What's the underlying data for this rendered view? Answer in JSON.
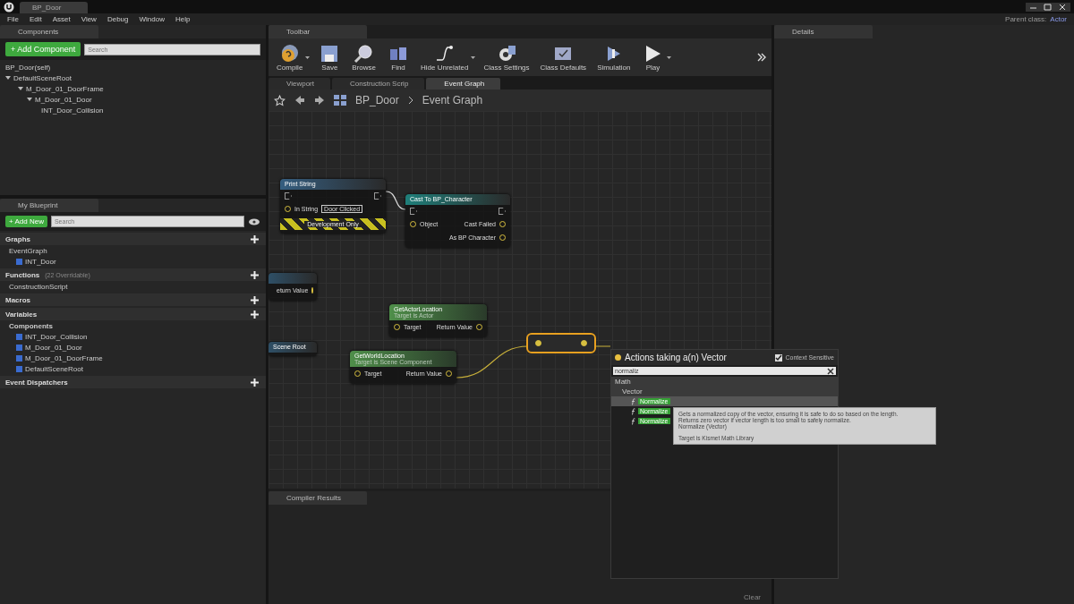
{
  "title_tab": {
    "label": "BP_Door"
  },
  "menu": [
    "File",
    "Edit",
    "Asset",
    "View",
    "Debug",
    "Window",
    "Help"
  ],
  "parent_class": {
    "label": "Parent class:",
    "value": "Actor"
  },
  "components": {
    "title": "Components",
    "add_button": "+ Add Component",
    "search": {
      "placeholder": "Search"
    },
    "tree": [
      {
        "label": "BP_Door(self)"
      },
      {
        "label": "DefaultSceneRoot",
        "children": [
          {
            "label": "M_Door_01_DoorFrame",
            "children": [
              {
                "label": "M_Door_01_Door",
                "children": [
                  {
                    "label": "INT_Door_Collision"
                  }
                ]
              }
            ]
          }
        ]
      }
    ]
  },
  "my_blueprint": {
    "title": "My Blueprint",
    "add_button": "+ Add New",
    "search": {
      "placeholder": "Search"
    },
    "sections": [
      {
        "label": "Graphs",
        "items": [
          {
            "label": "EventGraph",
            "children": [
              {
                "label": "INT_Door"
              }
            ]
          }
        ]
      },
      {
        "label": "Functions",
        "note": "(22 Overridable)",
        "items": [
          {
            "label": "ConstructionScript"
          }
        ]
      },
      {
        "label": "Macros"
      },
      {
        "label": "Variables",
        "items": [
          {
            "label": "Components",
            "children": [
              {
                "label": "INT_Door_Collision"
              },
              {
                "label": "M_Door_01_Door"
              },
              {
                "label": "M_Door_01_DoorFrame"
              },
              {
                "label": "DefaultSceneRoot"
              }
            ]
          }
        ]
      },
      {
        "label": "Event Dispatchers"
      }
    ]
  },
  "toolbar": {
    "title": "Toolbar",
    "buttons": [
      {
        "kind": "compile",
        "label": "Compile",
        "dropdown": true
      },
      {
        "kind": "save",
        "label": "Save",
        "dropdown": false
      },
      {
        "kind": "browse",
        "label": "Browse",
        "dropdown": false
      },
      {
        "kind": "find",
        "label": "Find",
        "dropdown": false
      },
      {
        "kind": "hide",
        "label": "Hide Unrelated",
        "dropdown": true
      },
      {
        "kind": "settings",
        "label": "Class Settings",
        "dropdown": false
      },
      {
        "kind": "defaults",
        "label": "Class Defaults",
        "dropdown": false
      },
      {
        "kind": "simulation",
        "label": "Simulation",
        "dropdown": false
      },
      {
        "kind": "play",
        "label": "Play",
        "dropdown": true
      }
    ]
  },
  "editor_tabs": [
    {
      "label": "Viewport",
      "selected": false
    },
    {
      "label": "Construction Scrip",
      "selected": false
    },
    {
      "label": "Event Graph",
      "selected": true
    }
  ],
  "breadcrumb": [
    "BP_Door",
    "Event Graph"
  ],
  "nodes": [
    {
      "kind": "print",
      "title": "Print String",
      "selected": false,
      "pins": [
        {
          "label": "In String",
          "value": "Door Clicked"
        }
      ],
      "footer": "Development Only"
    },
    {
      "kind": "cast",
      "title": "Cast To BP_Character",
      "selected": false,
      "pins": [
        {
          "label": "Object",
          "out": "Cast Failed"
        },
        {
          "out": "As BP Character"
        }
      ]
    },
    {
      "kind": "partial",
      "selected": false,
      "pins": [
        {
          "out": "eturn Value"
        }
      ]
    },
    {
      "kind": "var",
      "title": "Scene Root",
      "selected": false
    },
    {
      "kind": "function",
      "title": "GetActorLocation",
      "subtitle": "Target is Actor",
      "selected": false,
      "pins": [
        {
          "label": "Target",
          "out": "Return Value"
        }
      ]
    },
    {
      "kind": "function",
      "title": "GetWorldLocation",
      "subtitle": "Target is Scene Component",
      "selected": false,
      "pins": [
        {
          "label": "Target",
          "out": "Return Value"
        }
      ]
    },
    {
      "kind": "reroute",
      "selected": true
    }
  ],
  "action_menu": {
    "title": "Actions taking a(n) Vector",
    "context_sensitive": {
      "label": "Context Sensitive",
      "checked": true
    },
    "search": {
      "value": "normaliz"
    },
    "tree": [
      {
        "label": "Math",
        "children": [
          {
            "label": "Vector",
            "children": [
              {
                "label": "Normalize",
                "selected": true
              },
              {
                "label": "Normalize",
                "selected": false
              },
              {
                "label": "Normalize",
                "selected": false
              }
            ]
          }
        ]
      }
    ],
    "tooltip": [
      "Gets a normalized copy of the vector, ensuring it is safe to do so based on the length.",
      "Returns zero vector if vector length is too small to safely normalize.",
      "Normalize (Vector)",
      "Target is Kismet Math Library"
    ]
  },
  "details": {
    "title": "Details"
  },
  "compiler_results": {
    "title": "Compiler Results",
    "clear_button": "Clear"
  }
}
